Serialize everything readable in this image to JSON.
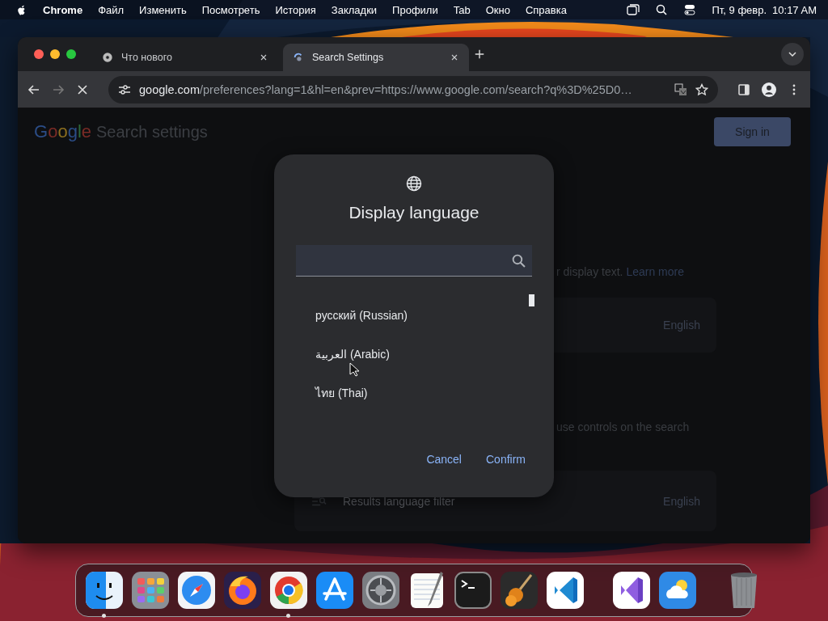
{
  "menu_bar": {
    "app": "Chrome",
    "items": [
      "Файл",
      "Изменить",
      "Посмотреть",
      "История",
      "Закладки",
      "Профили",
      "Tab",
      "Окно",
      "Справка"
    ],
    "date": "Пт, 9 февр.",
    "time": "10:17 AM"
  },
  "browser": {
    "tabs": [
      {
        "title": "Что нового",
        "selected": false,
        "kind": "chrome"
      },
      {
        "title": "Search Settings",
        "selected": true,
        "kind": "loading"
      }
    ],
    "address": {
      "host": "google.com",
      "path": "/preferences?lang=1&hl=en&prev=https://www.google.com/search?q%3D%25D0…"
    }
  },
  "page": {
    "logo": "Google",
    "title": "Search settings",
    "sign_in": "Sign in",
    "display_text": "r display text.",
    "learn_more": "Learn more",
    "language_value": "English",
    "controls_text": "use controls on the search",
    "filter_label": "Results language filter",
    "filter_value": "English"
  },
  "dialog": {
    "title": "Display language",
    "languages": [
      {
        "label": "русский  (Russian)"
      },
      {
        "label": "العربية  (Arabic)"
      },
      {
        "label": "ไทย  (Thai)"
      }
    ],
    "buttons": [
      {
        "label": "Cancel"
      },
      {
        "label": "Confirm"
      }
    ]
  },
  "dock": [
    {
      "kind": "finder",
      "running": true
    },
    {
      "kind": "launchpad",
      "running": false
    },
    {
      "kind": "safari",
      "running": false
    },
    {
      "kind": "firefox",
      "running": false
    },
    {
      "kind": "chrome",
      "running": true
    },
    {
      "kind": "appstore",
      "running": false
    },
    {
      "kind": "settings",
      "running": false
    },
    {
      "kind": "textedit",
      "running": false
    },
    {
      "kind": "terminal",
      "running": false
    },
    {
      "kind": "garageband",
      "running": false
    },
    {
      "kind": "vscode",
      "running": false
    },
    {
      "kind": "separator"
    },
    {
      "kind": "visualstudio",
      "running": false
    },
    {
      "kind": "weather",
      "running": false
    },
    {
      "kind": "separator"
    },
    {
      "kind": "trash",
      "running": false
    }
  ]
}
